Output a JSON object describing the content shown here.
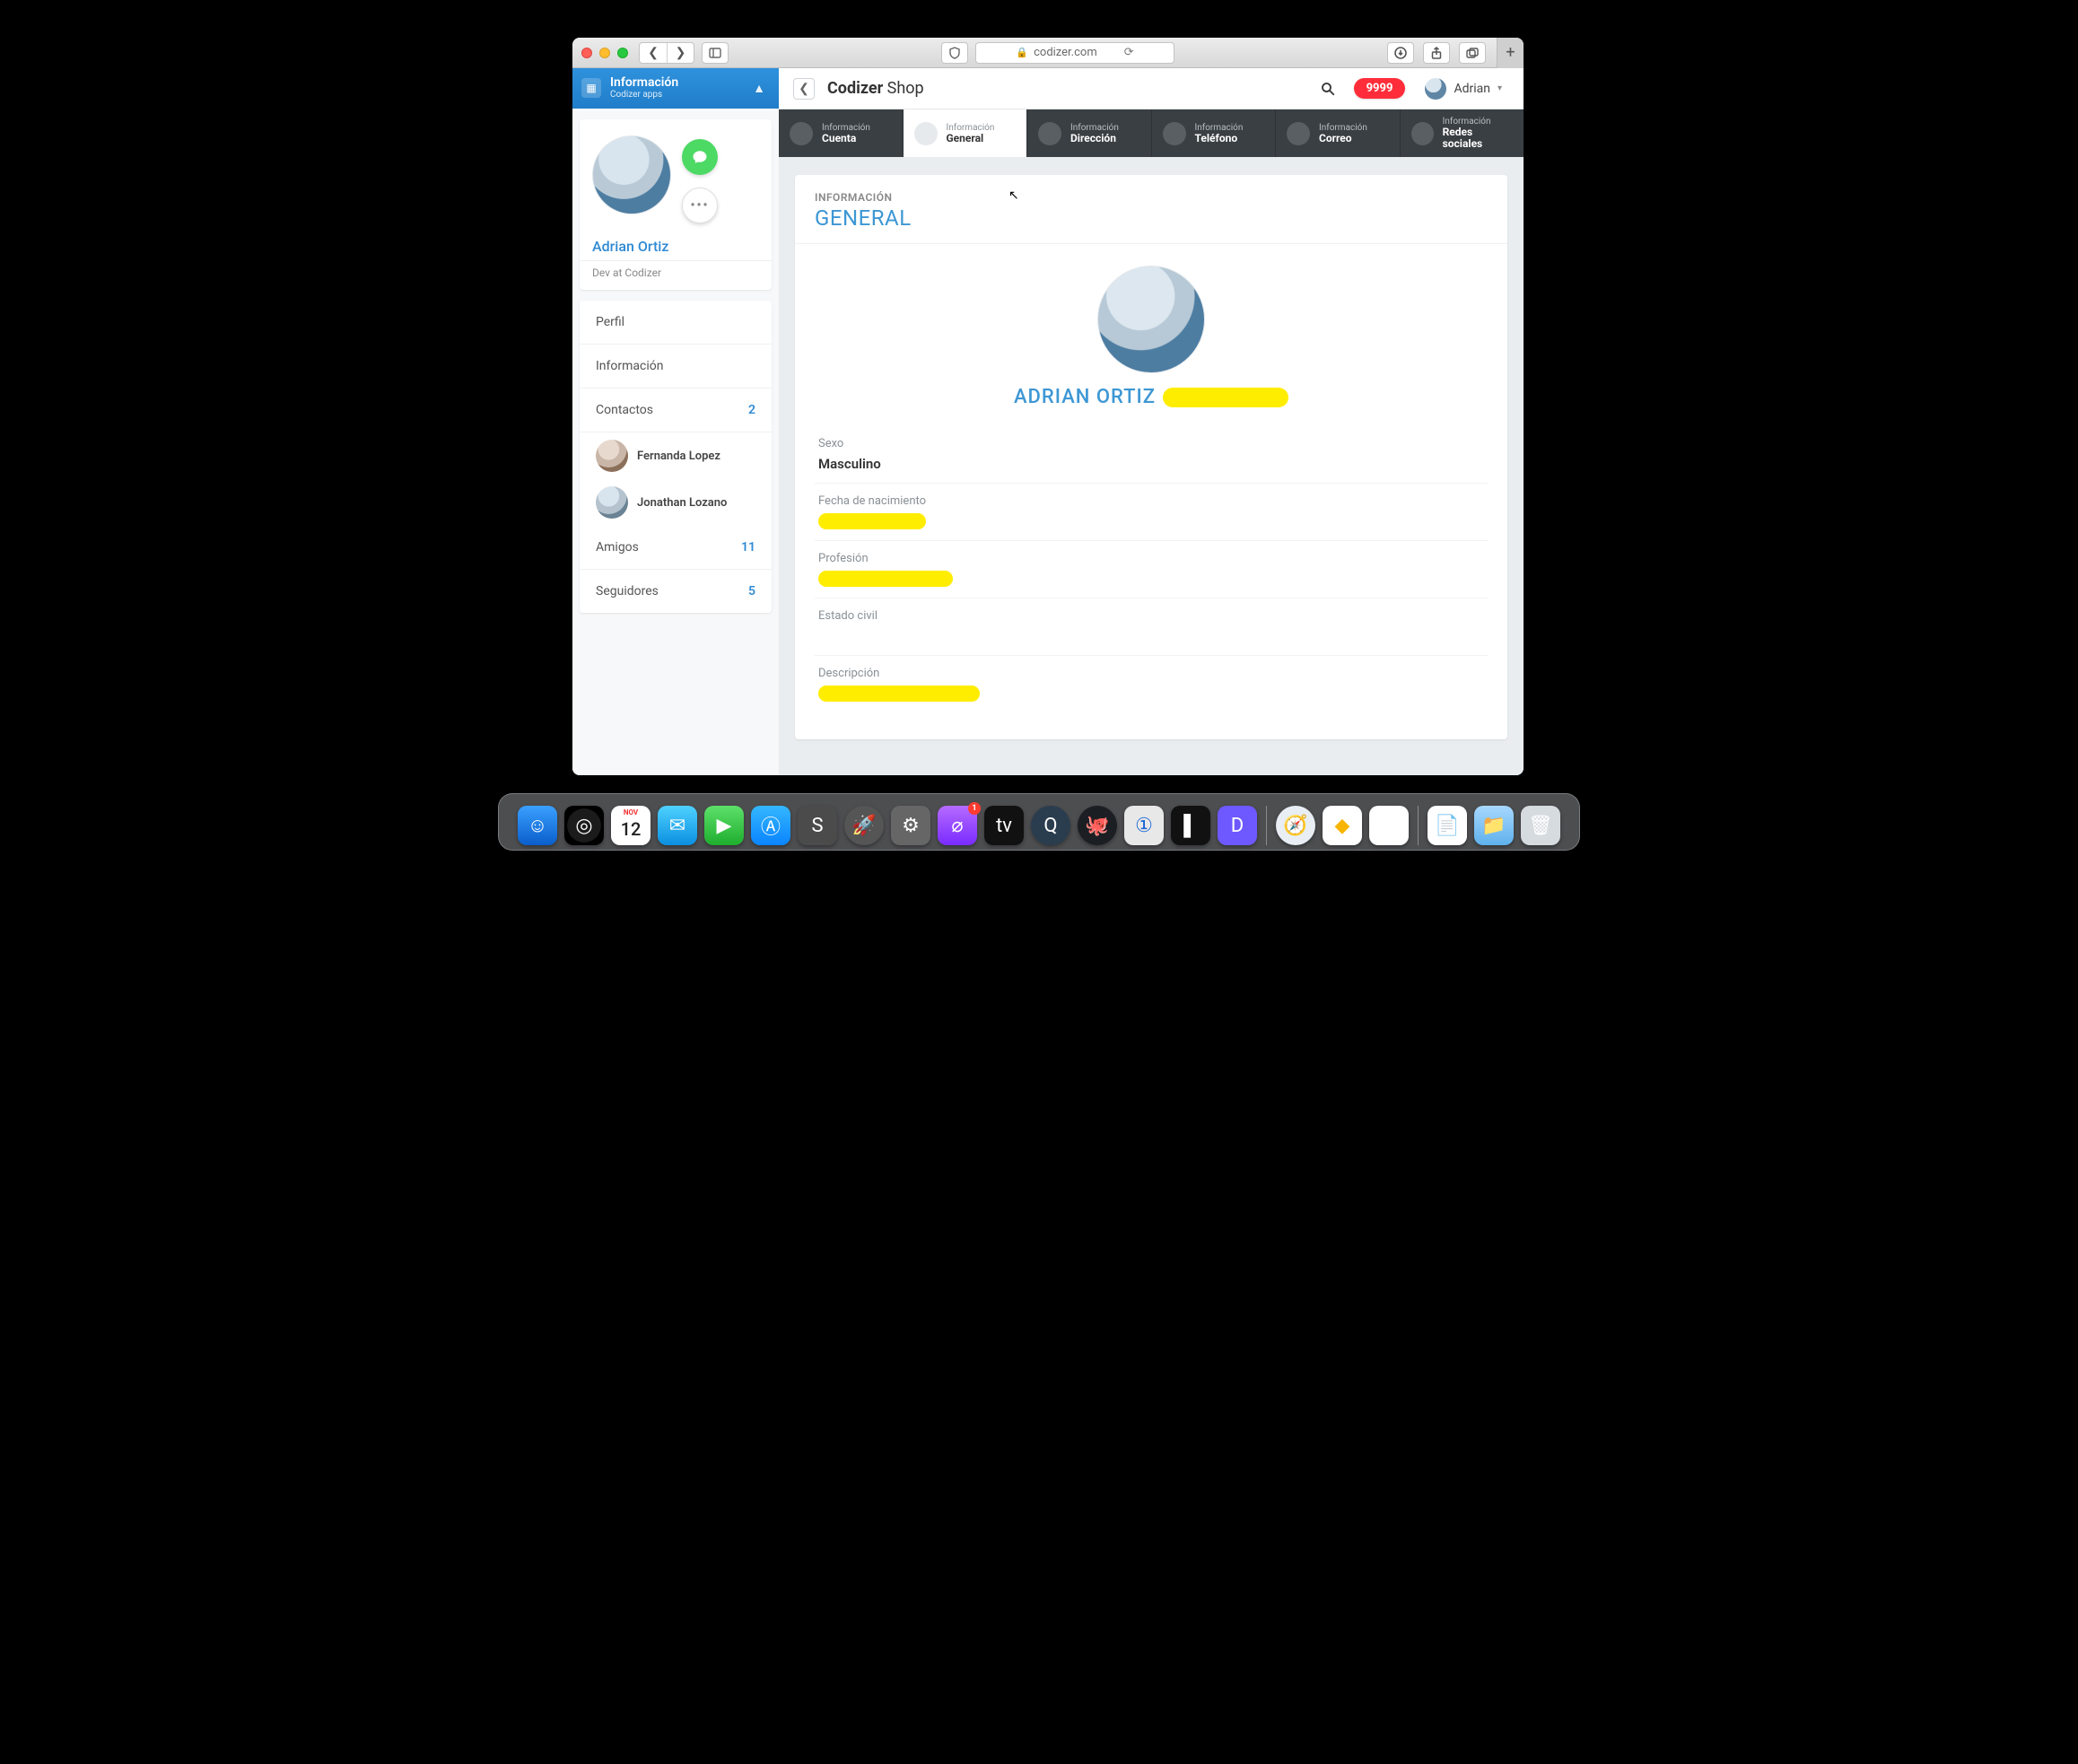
{
  "browser": {
    "url_host": "codizer.com"
  },
  "sidebar_header": {
    "title": "Información",
    "subtitle": "Codizer apps"
  },
  "profile": {
    "name": "Adrian Ortiz",
    "role": "Dev at Codizer"
  },
  "nav": {
    "perfil": "Perfil",
    "informacion": "Información",
    "contactos_label": "Contactos",
    "contactos_count": "2",
    "amigos_label": "Amigos",
    "amigos_count": "11",
    "seguidores_label": "Seguidores",
    "seguidores_count": "5",
    "contact1": "Fernanda Lopez",
    "contact2": "Jonathan Lozano"
  },
  "topbar": {
    "title_bold": "Codizer",
    "title_rest": " Shop",
    "badge": "9999",
    "user": "Adrian"
  },
  "tabs": {
    "small": "Información",
    "t1": "Cuenta",
    "t2": "General",
    "t3": "Dirección",
    "t4": "Teléfono",
    "t5": "Correo",
    "t6": "Redes sociales"
  },
  "panel": {
    "overline": "INFORMACIÓN",
    "heading": "GENERAL",
    "display_name": "ADRIAN ORTIZ",
    "sexo_label": "Sexo",
    "sexo_value": "Masculino",
    "fecha_label": "Fecha de nacimiento",
    "profesion_label": "Profesión",
    "estado_label": "Estado civil",
    "descripcion_label": "Descripción"
  },
  "dock": {
    "cal_month": "NOV",
    "cal_day": "12",
    "podcast_badge": "1"
  }
}
